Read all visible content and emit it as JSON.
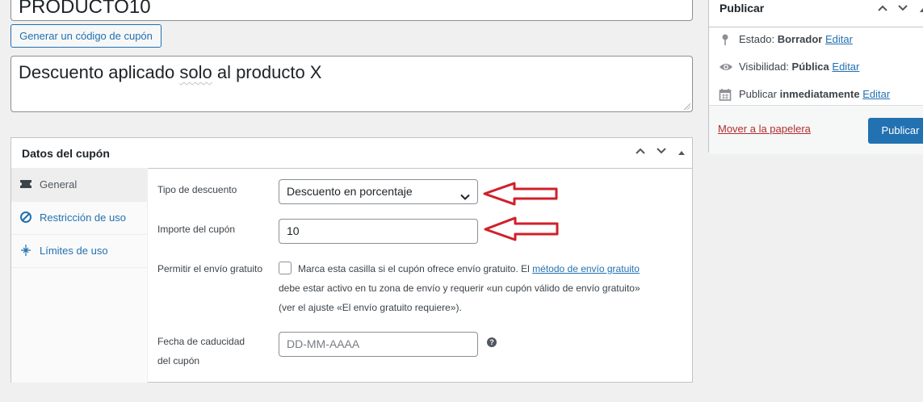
{
  "coupon": {
    "code_value": "PRODUCTO10",
    "generate_button": "Generar un código de cupón",
    "description_prefix": "Descuento aplicado ",
    "description_misspelled": "solo",
    "description_suffix": " al producto X"
  },
  "coupon_data": {
    "title": "Datos del cupón",
    "tabs": [
      {
        "label": "General",
        "icon": "ticket-icon",
        "active": true
      },
      {
        "label": "Restricción de uso",
        "icon": "restriction-icon"
      },
      {
        "label": "Límites de uso",
        "icon": "limits-icon"
      }
    ],
    "fields": {
      "discount_type_label": "Tipo de descuento",
      "discount_type_value": "Descuento en porcentaje",
      "amount_label": "Importe del cupón",
      "amount_value": "10",
      "free_shipping_label": "Permitir el envío gratuito",
      "free_shipping_text_1": "Marca esta casilla si el cupón ofrece envío gratuito. El ",
      "free_shipping_link": "método de envío gratuito",
      "free_shipping_text_2": "debe estar activo en tu zona de envío y requerir «un cupón válido de envío gratuito»",
      "free_shipping_text_3": "(ver el ajuste «El envío gratuito requiere»).",
      "expiry_label_1": "Fecha de caducidad",
      "expiry_label_2": "del cupón",
      "expiry_placeholder": "DD-MM-AAAA"
    }
  },
  "publish": {
    "title": "Publicar",
    "status_label": "Estado: ",
    "status_value": "Borrador",
    "visibility_label": "Visibilidad: ",
    "visibility_value": "Pública",
    "schedule_label": "Publicar ",
    "schedule_value": "inmediatamente",
    "edit_link": "Editar",
    "trash_link": "Mover a la papelera",
    "publish_button": "Publicar"
  },
  "colors": {
    "accent": "#2271b1",
    "annotation": "#d0202a",
    "trash": "#b32d2e"
  }
}
